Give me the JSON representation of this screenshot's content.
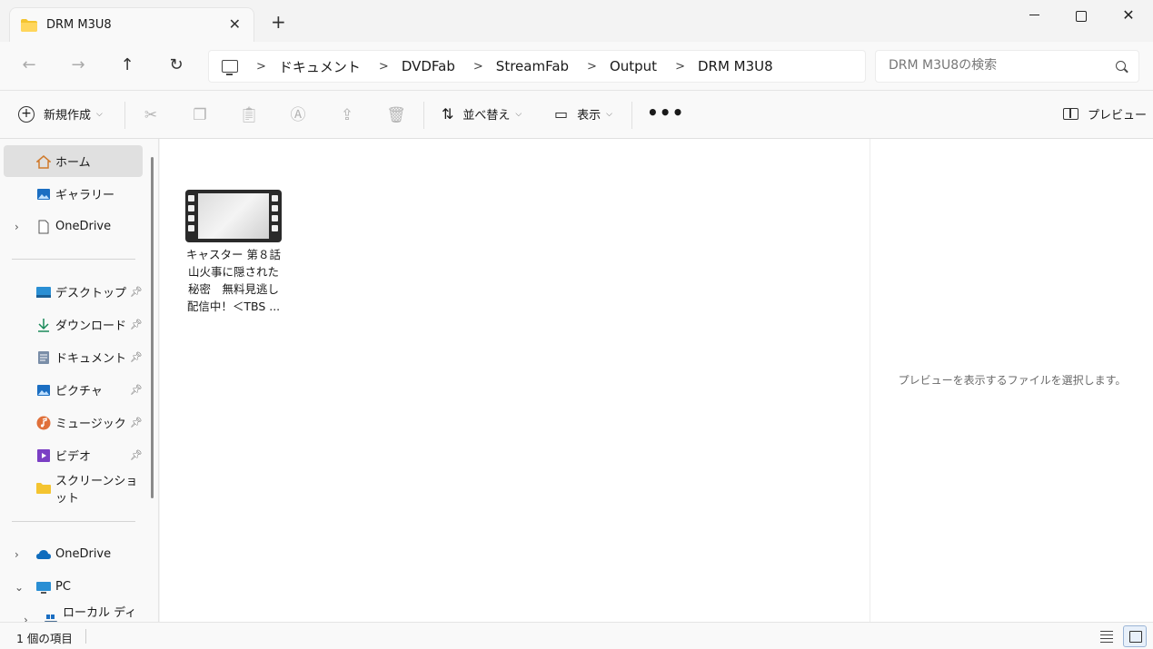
{
  "window": {
    "tab_title": "DRM M3U8",
    "tab_close": "✕",
    "tab_add": "+",
    "close_glyph": "✕"
  },
  "address": {
    "crumbs": [
      "ドキュメント",
      "DVDFab",
      "StreamFab",
      "Output",
      "DRM M3U8"
    ],
    "separator": ">",
    "search_placeholder": "DRM M3U8の検索"
  },
  "toolbar": {
    "new_label": "新規作成",
    "sort_label": "並べ替え",
    "view_label": "表示",
    "more_label": "•••",
    "preview_label": "プレビュー"
  },
  "sidebar": {
    "items": [
      {
        "label": "ホーム"
      },
      {
        "label": "ギャラリー"
      },
      {
        "label": "OneDrive"
      },
      {
        "label": "デスクトップ"
      },
      {
        "label": "ダウンロード"
      },
      {
        "label": "ドキュメント"
      },
      {
        "label": "ピクチャ"
      },
      {
        "label": "ミュージック"
      },
      {
        "label": "ビデオ"
      },
      {
        "label": "スクリーンショット"
      },
      {
        "label": "OneDrive"
      },
      {
        "label": "PC"
      },
      {
        "label": "ローカル ディスク"
      }
    ]
  },
  "files": [
    {
      "name_lines": [
        "キャスター 第８話",
        "山火事に隠された",
        "秘密　無料見逃し",
        "配信中！＜TBS ..."
      ]
    }
  ],
  "preview": {
    "message": "プレビューを表示するファイルを選択します。"
  },
  "status": {
    "count": "1 個の項目"
  },
  "colors": {
    "folder": "#f4c430",
    "onedrive_cloud": "#0f6cbd",
    "accent": "#0067c0"
  }
}
